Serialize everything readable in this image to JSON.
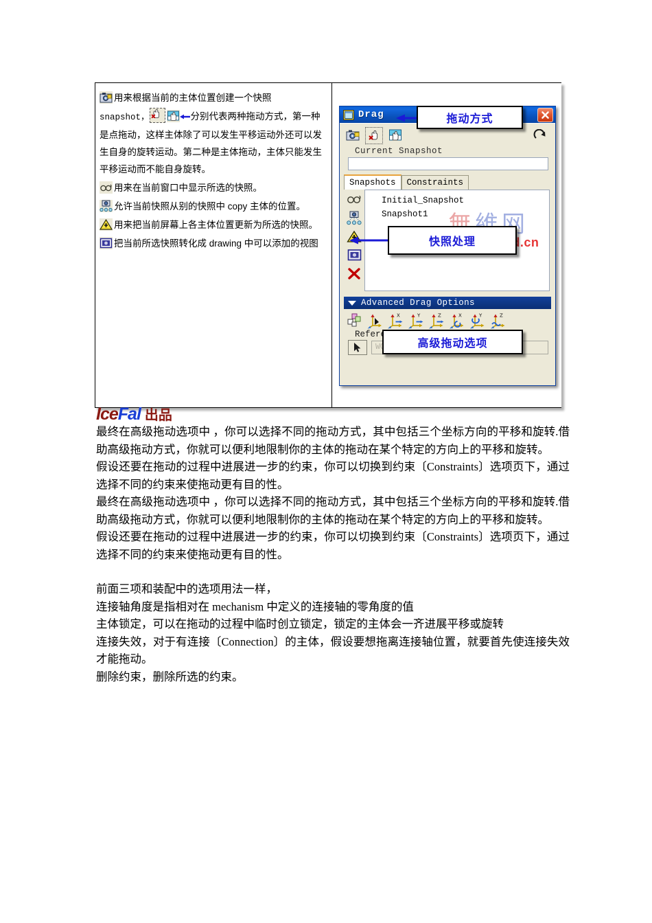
{
  "figure": {
    "left_panel": {
      "lines": [
        {
          "icon": "camera-snapshot-icon",
          "text": "用来根据当前的主体位置创建一个快照"
        },
        {
          "text_prefix": "snapshot，",
          "icon1": "point-drag-icon",
          "icon2": "body-drag-icon",
          "text": "分别代表两种拖动方式，第一种是点拖动，这样主体除了可以发生平移运动外还可以发生自身的旋转运动。第二种是主体拖动，主体只能发生平移运动而不能自身旋转。"
        },
        {
          "icon": "glasses-display-icon",
          "text": "用来在当前窗口中显示所选的快照。"
        },
        {
          "icon": "copy-snapshot-icon",
          "text": "允许当前快照从别的快照中 copy 主体的位置。"
        },
        {
          "icon": "warning-update-icon",
          "text": "用来把当前屏幕上各主体位置更新为所选的快照。"
        },
        {
          "icon": "make-drawing-view-icon",
          "text": "把当前所选快照转化成 drawing 中可以添加的视图"
        }
      ]
    },
    "dialog": {
      "title": "Drag",
      "title_icon": "window-icon",
      "close_icon": "close-icon",
      "toolbar": {
        "buttons": [
          {
            "name": "snapshot-button",
            "icon": "camera-snapshot-icon"
          },
          {
            "name": "point-drag-button",
            "icon": "point-drag-icon",
            "pressed": true
          },
          {
            "name": "body-drag-button",
            "icon": "body-drag-icon"
          }
        ],
        "redo": {
          "name": "redo-button",
          "icon": "redo-icon"
        }
      },
      "current_snapshot": {
        "label": "Current Snapshot",
        "value": "",
        "placeholder": ""
      },
      "tabs": [
        {
          "label": "Snapshots",
          "active": true
        },
        {
          "label": "Constraints",
          "active": false
        }
      ],
      "snapshot_sidebar": [
        {
          "name": "display-snapshot-button",
          "icon": "glasses-display-icon"
        },
        {
          "name": "copy-position-button",
          "icon": "copy-snapshot-icon"
        },
        {
          "name": "update-screen-button",
          "icon": "warning-update-icon"
        },
        {
          "name": "make-drawing-view-button",
          "icon": "make-drawing-view-icon"
        },
        {
          "name": "delete-snapshot-button",
          "icon": "delete-x-icon"
        }
      ],
      "snapshot_list": [
        "Initial_Snapshot",
        "Snapshot1"
      ],
      "advanced": {
        "header": "Advanced Drag Options",
        "caret_icon": "caret-down-icon",
        "tools": [
          {
            "name": "packaging-move-button",
            "icon": "packaging-icon"
          },
          {
            "name": "free-drag-button",
            "icon": "free-drag-axes-icon"
          },
          {
            "name": "translate-x-button",
            "icon": "translate-x-icon"
          },
          {
            "name": "translate-y-button",
            "icon": "translate-y-icon"
          },
          {
            "name": "translate-z-button",
            "icon": "translate-z-icon"
          },
          {
            "name": "rotate-x-button",
            "icon": "rotate-x-icon"
          },
          {
            "name": "rotate-y-button",
            "icon": "rotate-y-icon"
          },
          {
            "name": "rotate-z-button",
            "icon": "rotate-z-icon"
          }
        ],
        "reference_label": "Reference",
        "reference_select_icon": "cursor-arrow-icon",
        "reference_value": "WCS"
      }
    },
    "callouts": [
      {
        "name": "callout-drag-mode",
        "text": "拖动方式"
      },
      {
        "name": "callout-snapshot-handling",
        "text": "快照处理"
      },
      {
        "name": "callout-advanced-drag-options",
        "text": "高级拖动选项"
      }
    ],
    "watermark": {
      "cn_chars": [
        "無",
        "維",
        "网"
      ],
      "cn_colors": [
        "#e07070",
        "#6a7fd0",
        "#6a7fd0"
      ],
      "url": "www.5dcad.cn",
      "url_color": "#e21111"
    }
  },
  "logo": {
    "part_a": "Ice",
    "part_b": "Fal",
    "part_c": "出品"
  },
  "body": {
    "paragraphs": [
      "最终在高级拖动选项中 ，你可以选择不同的拖动方式，其中包括三个坐标方向的平移和旋转.借助高级拖动方式，你就可以便利地限制你的主体的拖动在某个特定的方向上的平移和旋转。",
      "假设还要在拖动的过程中进展进一步的约束，你可以切换到约束〔Constraints〕选项页下，通过选择不同的约束来使拖动更有目的性。",
      "最终在高级拖动选项中 ，你可以选择不同的拖动方式，其中包括三个坐标方向的平移和旋转.借助高级拖动方式，你就可以便利地限制你的主体的拖动在某个特定的方向上的平移和旋转。",
      "假设还要在拖动的过程中进展进一步的约束，你可以切换到约束〔Constraints〕选项页下，通过选择不同的约束来使拖动更有目的性。"
    ],
    "paragraphs2": [
      "前面三项和装配中的选项用法一样，",
      "连接轴角度是指相对在 mechanism 中定义的连接轴的零角度的值",
      "主体锁定，可以在拖动的过程中临时创立锁定，锁定的主体会一齐进展平移或旋转",
      "连接失效，对于有连接〔Connection〕的主体，假设要想拖离连接轴位置，就要首先使连接失效才能拖动。",
      "删除约束，删除所选的约束。"
    ]
  }
}
